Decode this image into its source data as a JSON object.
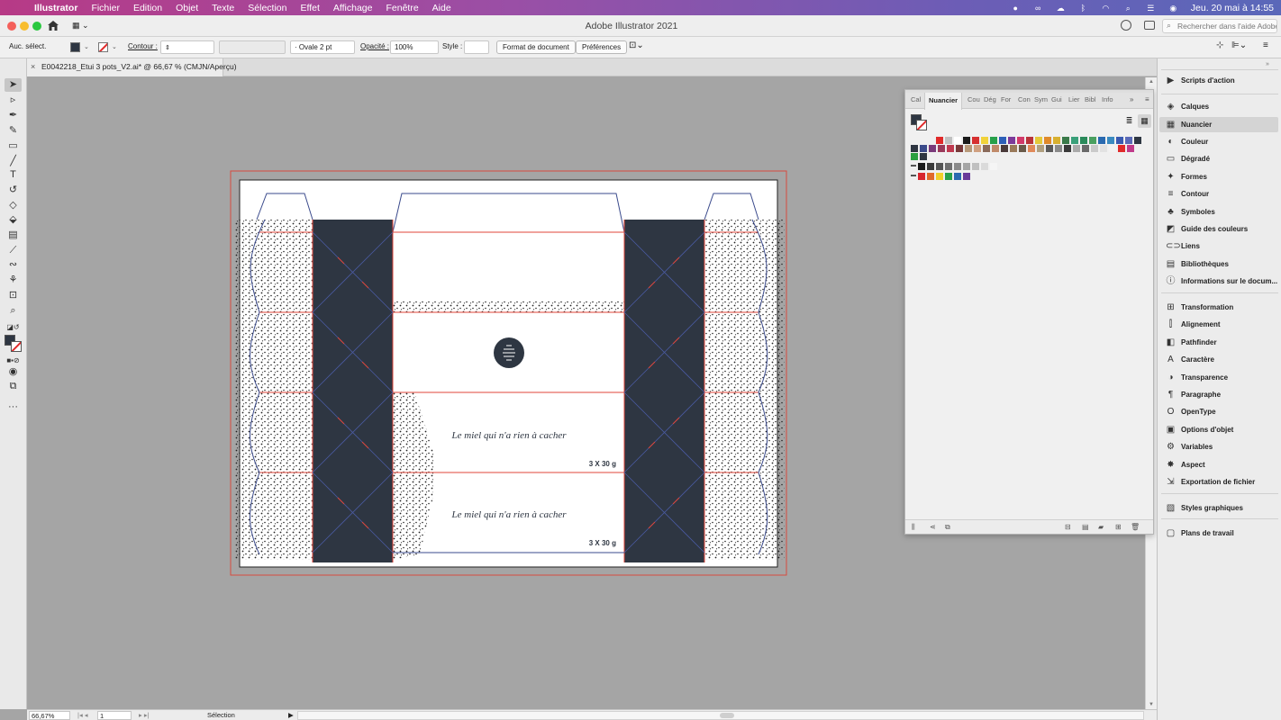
{
  "menubar": {
    "apple": "",
    "app_name": "Illustrator",
    "items": [
      "Fichier",
      "Edition",
      "Objet",
      "Texte",
      "Sélection",
      "Effet",
      "Affichage",
      "Fenêtre",
      "Aide"
    ],
    "datetime": "Jeu. 20 mai à  14:55"
  },
  "window": {
    "title": "Adobe Illustrator 2021",
    "help_search_placeholder": "Rechercher dans l'aide Adobe"
  },
  "controlbar": {
    "selection_label": "Auc. sélect.",
    "stroke_label": "Contour :",
    "brush_value": "Ovale 2 pt",
    "opacity_label": "Opacité :",
    "opacity_value": "100%",
    "style_label": "Style :",
    "doc_setup_button": "Format de document",
    "prefs_button": "Préférences"
  },
  "document": {
    "tab_label": "E0042218_Etui 3 pots_V2.ai* @ 66,67 % (CMJN/Aperçu)"
  },
  "artwork": {
    "slogan_1": "Le miel qui n'a rien à cacher",
    "slogan_2": "Le miel qui n'a rien à cacher",
    "weight_1": "3 X 30 g",
    "weight_2": "3 X 30 g",
    "colors": {
      "dark": "#2e3642",
      "cut_line": "#e0463a",
      "fold_line": "#3a4a8c",
      "bleed": "#d84a3e"
    }
  },
  "statusbar": {
    "zoom": "66,67%",
    "page": "1",
    "tool": "Sélection"
  },
  "swatch_panel": {
    "tabs": [
      "Cal",
      "Nuancier",
      "Cou",
      "Dég",
      "For",
      "Con",
      "Sym",
      "Gui",
      "Lier",
      "Bibl",
      "Info"
    ],
    "active_tab": "Nuancier",
    "swatch_rows": [
      [
        "#e02a2a",
        "#c0c0c0",
        "#ffffff",
        "#1b1b1b",
        "#d63030",
        "#f1d23a",
        "#27a04a",
        "#2d5fb8",
        "#7c3a9a",
        "#d23a6a",
        "#b8333a",
        "#e4c93a",
        "#e08a2a",
        "#d8b030",
        "#3a7a4a",
        "#3aa07a",
        "#2a8a5a",
        "#4aa060",
        "#2a6ab0",
        "#3a8ac0",
        "#3a5ab0",
        "#5a6ab8",
        "#2e3642"
      ],
      [
        "#2e3642",
        "#3a4a8a",
        "#7a3a7a",
        "#9a3a5a",
        "#c03a50",
        "#7a3a3a",
        "#b89a7a",
        "#d0a080",
        "#8a6a5a",
        "#c08a6a",
        "#4a3a3a",
        "#9a7a5a",
        "#6a5a4a",
        "#e08a5a",
        "#b0a080",
        "#5a5a5a",
        "#8a8a8a",
        "#3a3a3a",
        "#aaaaaa",
        "#6a6a6a",
        "#cacaca",
        "#e2e2e2",
        "#f2f2f2",
        "#e02a2a",
        "#c03a8a"
      ],
      [
        "#2aa040",
        "#2e3642"
      ],
      [
        "#1b1b1b",
        "#3a3a3a",
        "#555555",
        "#6f6f6f",
        "#8a8a8a",
        "#a5a5a5",
        "#c0c0c0",
        "#dadada",
        "#f5f5f5"
      ],
      [
        "#d8262e",
        "#e06a2a",
        "#f0d02a",
        "#27a04a",
        "#2a6ab0",
        "#6a3a9a"
      ]
    ]
  },
  "dock": {
    "items": [
      {
        "label": "Scripts d'action",
        "icon": "▶"
      },
      {
        "label": "Calques",
        "icon": "◈"
      },
      {
        "label": "Nuancier",
        "icon": "▦",
        "active": true
      },
      {
        "label": "Couleur",
        "icon": "◐"
      },
      {
        "label": "Dégradé",
        "icon": "▭"
      },
      {
        "label": "Formes",
        "icon": "✦"
      },
      {
        "label": "Contour",
        "icon": "≡"
      },
      {
        "label": "Symboles",
        "icon": "♣"
      },
      {
        "label": "Guide des couleurs",
        "icon": "◩"
      },
      {
        "label": "Liens",
        "icon": "⊂⊃"
      },
      {
        "label": "Bibliothèques",
        "icon": "▤"
      },
      {
        "label": "Informations sur le docum...",
        "icon": "ⓘ"
      },
      {
        "label": "Transformation",
        "icon": "⊞"
      },
      {
        "label": "Alignement",
        "icon": "⫿"
      },
      {
        "label": "Pathfinder",
        "icon": "◧"
      },
      {
        "label": "Caractère",
        "icon": "A"
      },
      {
        "label": "Transparence",
        "icon": "◑"
      },
      {
        "label": "Paragraphe",
        "icon": "¶"
      },
      {
        "label": "OpenType",
        "icon": "O"
      },
      {
        "label": "Options d'objet",
        "icon": "▣"
      },
      {
        "label": "Variables",
        "icon": "⚙"
      },
      {
        "label": "Aspect",
        "icon": "✸"
      },
      {
        "label": "Exportation de fichier",
        "icon": "⇲"
      },
      {
        "label": "Styles graphiques",
        "icon": "▧"
      },
      {
        "label": "Plans de travail",
        "icon": "▢"
      }
    ]
  }
}
